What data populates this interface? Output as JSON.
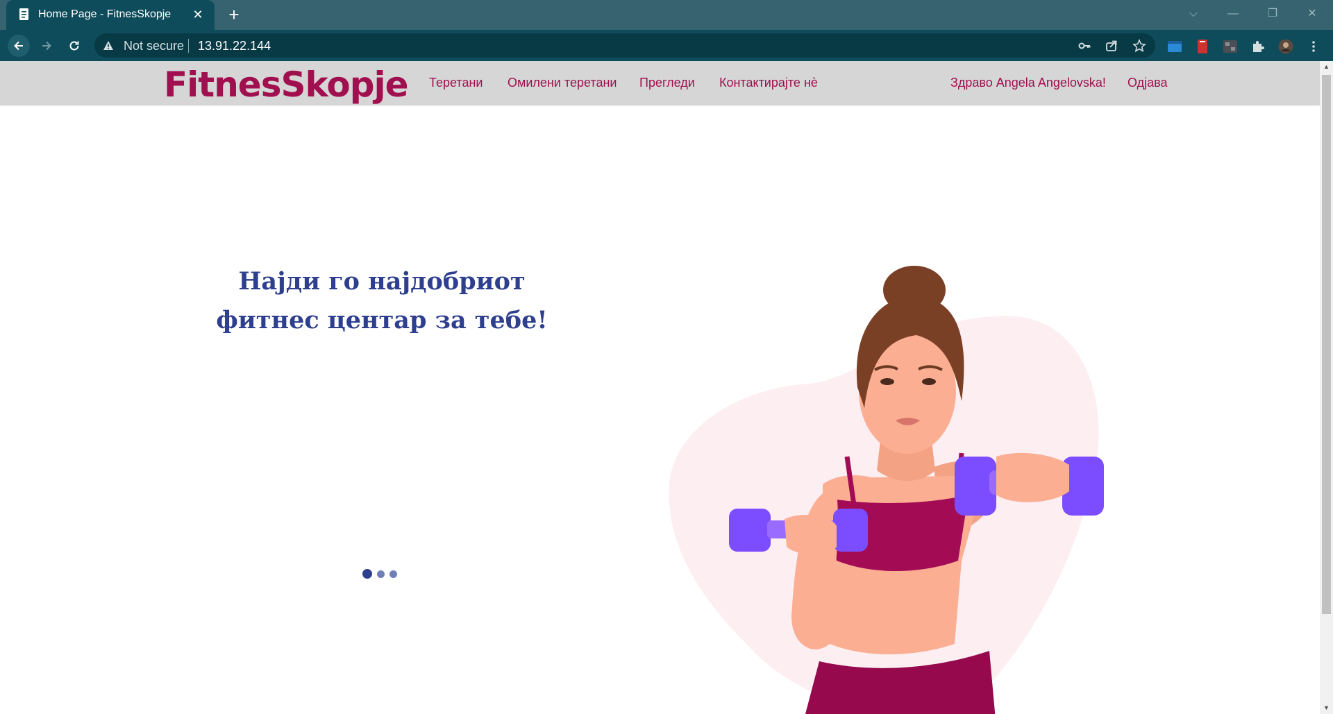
{
  "browser": {
    "tab_title": "Home Page - FitnesSkopje",
    "tab_close": "✕",
    "new_tab": "+",
    "security_label": "Not secure",
    "url": "13.91.22.144",
    "window_controls": {
      "dropdown": "⌵",
      "minimize": "—",
      "restore": "❐",
      "close": "✕"
    }
  },
  "site": {
    "logo": "FitnesSkopje",
    "nav": {
      "gyms": "Теретани",
      "favorite_gyms": "Омилени теретани",
      "reviews": "Прегледи",
      "contact": "Контактирајте нè"
    },
    "greeting": "Здраво Angela Angelovska!",
    "logout": "Одјава"
  },
  "hero": {
    "title_line1": "Најди го најдобриот",
    "title_line2": "фитнес центар за тебе!",
    "carousel": {
      "slides": 3,
      "active": 1
    }
  },
  "colors": {
    "brand": "#a0104f",
    "heading": "#2d3f8e",
    "navbar_bg": "#d6d6d6",
    "chrome": "#0e4c5b"
  }
}
